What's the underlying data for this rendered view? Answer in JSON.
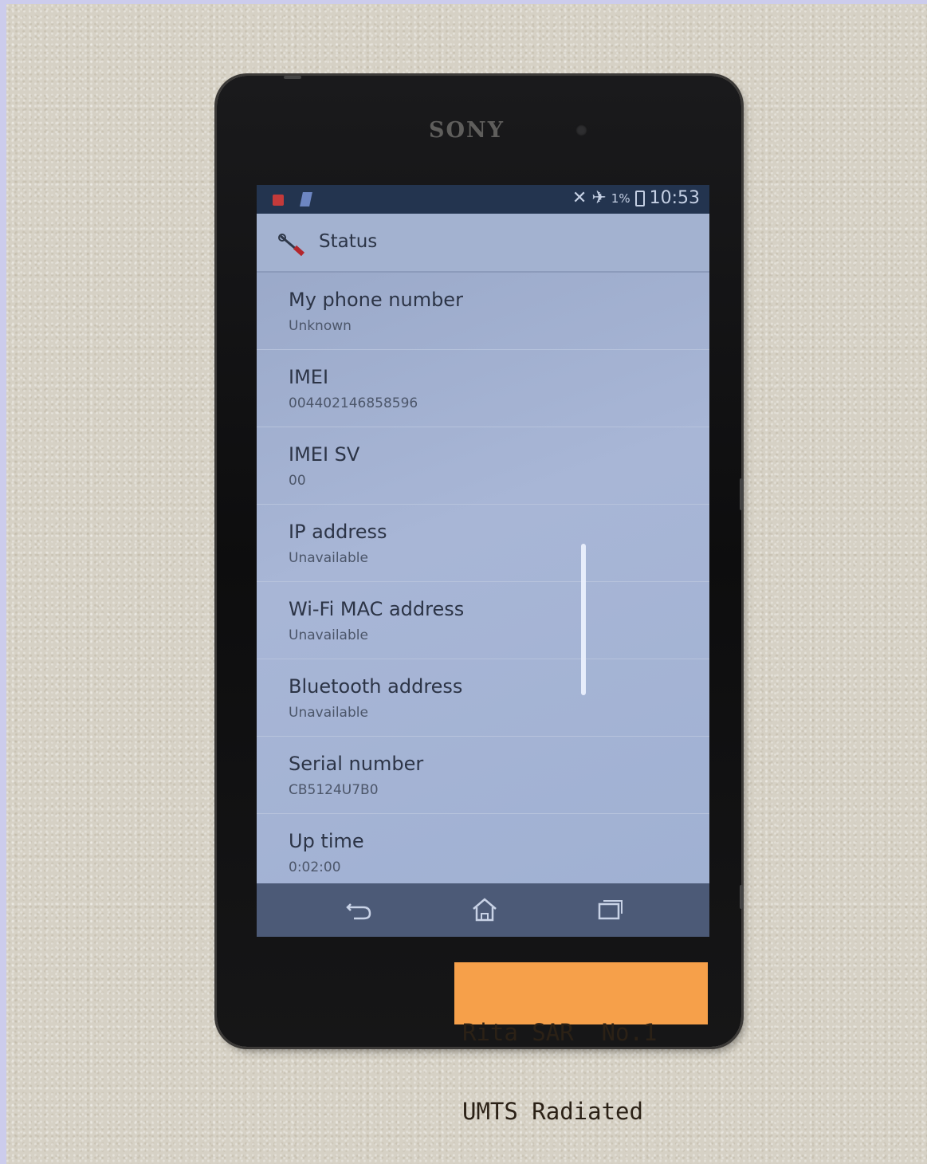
{
  "device": {
    "brand": "SONY"
  },
  "status_bar": {
    "battery_percent": "1%",
    "time": "10:53",
    "icons": [
      "notification-red-icon",
      "notification-blue-icon",
      "no-signal-icon",
      "airplane-mode-icon",
      "battery-icon"
    ]
  },
  "action_bar": {
    "title": "Status",
    "icon": "settings-icon"
  },
  "status_items": [
    {
      "title": "My phone number",
      "value": "Unknown"
    },
    {
      "title": "IMEI",
      "value": "004402146858596"
    },
    {
      "title": "IMEI SV",
      "value": "00"
    },
    {
      "title": "IP address",
      "value": "Unavailable"
    },
    {
      "title": "Wi-Fi MAC address",
      "value": "Unavailable"
    },
    {
      "title": "Bluetooth address",
      "value": "Unavailable"
    },
    {
      "title": "Serial number",
      "value": "CB5124U7B0"
    },
    {
      "title": "Up time",
      "value": "0:02:00"
    }
  ],
  "nav_bar": {
    "buttons": [
      "back-icon",
      "home-icon",
      "recent-apps-icon"
    ]
  },
  "sticker": {
    "line1": "Rita SAR  No.1",
    "line2": "UMTS Radiated",
    "color": "#f6a04a"
  }
}
